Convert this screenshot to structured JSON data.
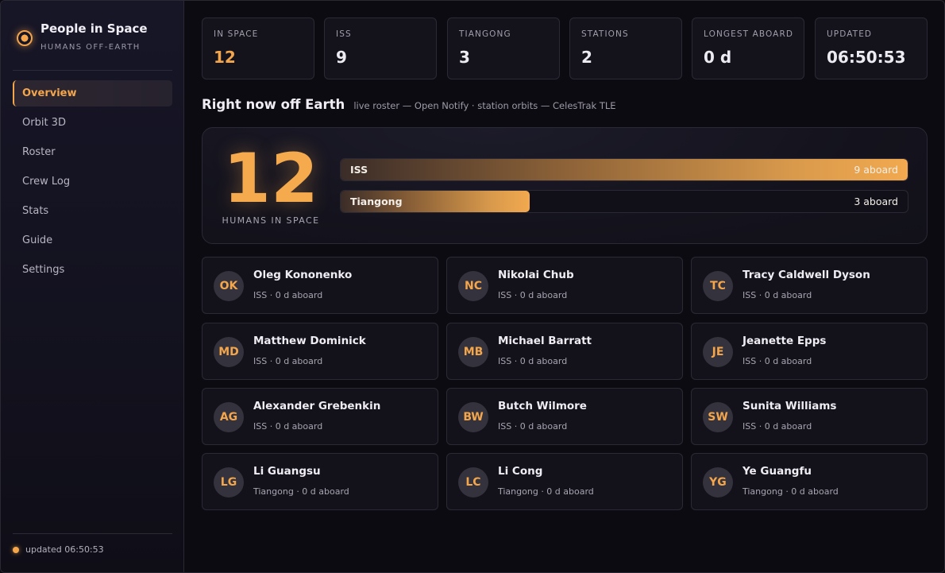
{
  "brand": {
    "title": "People in Space",
    "subtitle": "HUMANS OFF-EARTH",
    "icon": "orbit-dot-icon"
  },
  "nav": {
    "items": [
      {
        "label": "Overview",
        "active": true
      },
      {
        "label": "Orbit 3D",
        "active": false
      },
      {
        "label": "Roster",
        "active": false
      },
      {
        "label": "Crew Log",
        "active": false
      },
      {
        "label": "Stats",
        "active": false
      },
      {
        "label": "Guide",
        "active": false
      },
      {
        "label": "Settings",
        "active": false
      }
    ]
  },
  "footer": {
    "status_text": "updated 06:50:53"
  },
  "stats": [
    {
      "label": "IN SPACE",
      "value": "12",
      "accent": true
    },
    {
      "label": "ISS",
      "value": "9",
      "accent": false
    },
    {
      "label": "TIANGONG",
      "value": "3",
      "accent": false
    },
    {
      "label": "STATIONS",
      "value": "2",
      "accent": false
    },
    {
      "label": "LONGEST ABOARD",
      "value": "0 d",
      "accent": false
    },
    {
      "label": "UPDATED",
      "value": "06:50:53",
      "accent": false
    }
  ],
  "section": {
    "title": "Right now off Earth",
    "note": "live roster — Open Notify · station orbits — CelesTrak TLE"
  },
  "hero": {
    "count": "12",
    "caption": "HUMANS IN SPACE",
    "stations": [
      {
        "name": "ISS",
        "count_label": "9 aboard",
        "fraction": 1.0
      },
      {
        "name": "Tiangong",
        "count_label": "3 aboard",
        "fraction": 0.333
      }
    ]
  },
  "crew": [
    {
      "initials": "OK",
      "name": "Oleg Kononenko",
      "meta": "ISS · 0 d aboard"
    },
    {
      "initials": "NC",
      "name": "Nikolai Chub",
      "meta": "ISS · 0 d aboard"
    },
    {
      "initials": "TC",
      "name": "Tracy Caldwell Dyson",
      "meta": "ISS · 0 d aboard"
    },
    {
      "initials": "MD",
      "name": "Matthew Dominick",
      "meta": "ISS · 0 d aboard"
    },
    {
      "initials": "MB",
      "name": "Michael Barratt",
      "meta": "ISS · 0 d aboard"
    },
    {
      "initials": "JE",
      "name": "Jeanette Epps",
      "meta": "ISS · 0 d aboard"
    },
    {
      "initials": "AG",
      "name": "Alexander Grebenkin",
      "meta": "ISS · 0 d aboard"
    },
    {
      "initials": "BW",
      "name": "Butch Wilmore",
      "meta": "ISS · 0 d aboard"
    },
    {
      "initials": "SW",
      "name": "Sunita Williams",
      "meta": "ISS · 0 d aboard"
    },
    {
      "initials": "LG",
      "name": "Li Guangsu",
      "meta": "Tiangong · 0 d aboard"
    },
    {
      "initials": "LC",
      "name": "Li Cong",
      "meta": "Tiangong · 0 d aboard"
    },
    {
      "initials": "YG",
      "name": "Ye Guangfu",
      "meta": "Tiangong · 0 d aboard"
    }
  ],
  "colors": {
    "accent": "#f4a64c",
    "background": "#0c0b11",
    "sidebar": "#171627",
    "card": "#13121a",
    "border": "#2b2935"
  }
}
